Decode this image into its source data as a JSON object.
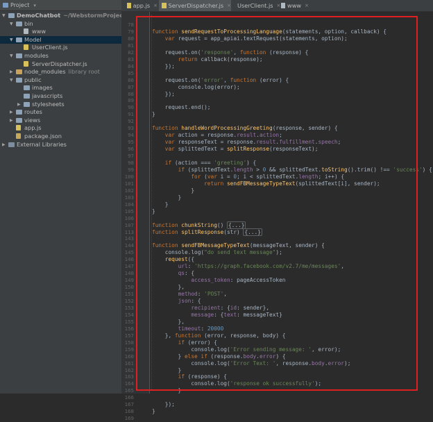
{
  "sidebar": {
    "header_label": "Project",
    "tree": [
      {
        "label": "DemoChatbot",
        "sub": "~/WebstormProjects/Dem",
        "indent": 0,
        "expanded": true,
        "icon": "folder-icon",
        "kind": "folder",
        "bold": true
      },
      {
        "label": "bin",
        "sub": "",
        "indent": 1,
        "expanded": true,
        "icon": "folder-icon",
        "kind": "folder"
      },
      {
        "label": "www",
        "sub": "",
        "indent": 2,
        "expanded": null,
        "icon": "file-icon",
        "kind": "file"
      },
      {
        "label": "Model",
        "sub": "",
        "indent": 1,
        "expanded": true,
        "icon": "folder-icon",
        "kind": "folder",
        "selected": true
      },
      {
        "label": "UserClient.js",
        "sub": "",
        "indent": 2,
        "expanded": null,
        "icon": "js-file-icon",
        "kind": "js"
      },
      {
        "label": "modules",
        "sub": "",
        "indent": 1,
        "expanded": true,
        "icon": "folder-icon",
        "kind": "folder"
      },
      {
        "label": "ServerDispatcher.js",
        "sub": "",
        "indent": 2,
        "expanded": null,
        "icon": "js-file-icon",
        "kind": "js"
      },
      {
        "label": "node_modules",
        "sub": "library root",
        "indent": 1,
        "expanded": false,
        "icon": "folder-icon",
        "kind": "folder-gold"
      },
      {
        "label": "public",
        "sub": "",
        "indent": 1,
        "expanded": true,
        "icon": "folder-icon",
        "kind": "folder"
      },
      {
        "label": "images",
        "sub": "",
        "indent": 2,
        "expanded": null,
        "icon": "folder-icon",
        "kind": "folder"
      },
      {
        "label": "javascripts",
        "sub": "",
        "indent": 2,
        "expanded": null,
        "icon": "folder-icon",
        "kind": "folder"
      },
      {
        "label": "stylesheets",
        "sub": "",
        "indent": 2,
        "expanded": false,
        "icon": "folder-icon",
        "kind": "folder"
      },
      {
        "label": "routes",
        "sub": "",
        "indent": 1,
        "expanded": false,
        "icon": "folder-icon",
        "kind": "folder"
      },
      {
        "label": "views",
        "sub": "",
        "indent": 1,
        "expanded": false,
        "icon": "folder-icon",
        "kind": "folder"
      },
      {
        "label": "app.js",
        "sub": "",
        "indent": 1,
        "expanded": null,
        "icon": "js-file-icon",
        "kind": "js"
      },
      {
        "label": "package.json",
        "sub": "",
        "indent": 1,
        "expanded": null,
        "icon": "json-file-icon",
        "kind": "json"
      },
      {
        "label": "External Libraries",
        "sub": "",
        "indent": 0,
        "expanded": false,
        "icon": "library-icon",
        "kind": "folder-ext"
      }
    ]
  },
  "tabs": [
    {
      "label": "app.js",
      "icon": "js",
      "active": false
    },
    {
      "label": "ServerDispatcher.js",
      "icon": "js",
      "active": true
    },
    {
      "label": "UserClient.js",
      "icon": "js",
      "active": false
    },
    {
      "label": "www",
      "icon": "file",
      "active": false
    }
  ],
  "editor": {
    "lines": [
      {
        "n": "78",
        "code": ""
      },
      {
        "n": "79",
        "code": "<span class=\"kw\">function </span><span class=\"fn\">sendRequestToProcessingLanguage</span>(statements, option, callback) {"
      },
      {
        "n": "80",
        "code": "    <span class=\"kw\">var </span>request = app_apiai.textRequest(statements, option);"
      },
      {
        "n": "81",
        "code": ""
      },
      {
        "n": "82",
        "code": "    request.on(<span class=\"str\">'response'</span>, <span class=\"kw\">function </span>(response) {"
      },
      {
        "n": "83",
        "code": "        <span class=\"kw\">return </span>callback(response);"
      },
      {
        "n": "84",
        "code": "    });"
      },
      {
        "n": "85",
        "code": ""
      },
      {
        "n": "86",
        "code": "    request.on(<span class=\"str\">'error'</span>, <span class=\"kw\">function </span>(error) {"
      },
      {
        "n": "87",
        "code": "        console.log(error);"
      },
      {
        "n": "88",
        "code": "    });"
      },
      {
        "n": "89",
        "code": ""
      },
      {
        "n": "90",
        "code": "    request.end();"
      },
      {
        "n": "91",
        "code": "}"
      },
      {
        "n": "92",
        "code": ""
      },
      {
        "n": "93",
        "code": "<span class=\"kw\">function </span><span class=\"fn\">handleWordProcessingGreeting</span>(response, sender) {"
      },
      {
        "n": "94",
        "code": "    <span class=\"kw\">var </span>action = response.<span class=\"prop\">result</span>.<span class=\"prop\">action</span>;"
      },
      {
        "n": "95",
        "code": "    <span class=\"kw\">var </span>responseText = response.<span class=\"prop\">result</span>.<span class=\"prop\">fulfillment</span>.<span class=\"prop\">speech</span>;"
      },
      {
        "n": "96",
        "code": "    <span class=\"kw\">var </span>splittedText = <span class=\"fn\">splitResponse</span>(responseText);"
      },
      {
        "n": "97",
        "code": ""
      },
      {
        "n": "98",
        "code": "    <span class=\"kw\">if </span>(action === <span class=\"str\">'greeting'</span>) {"
      },
      {
        "n": "99",
        "code": "        <span class=\"kw\">if </span>(splittedText.<span class=\"prop\">length </span>&gt; <span class=\"num\">0 </span>&amp;&amp; splittedText.<span class=\"fn\">toString</span>().trim() !== <span class=\"str\">'success'</span>) {"
      },
      {
        "n": "100",
        "code": "            <span class=\"kw\">for </span>(<span class=\"kw\">var </span>i = <span class=\"num\">0</span>; i &lt; splittedText.<span class=\"prop\">length</span>; i++) {"
      },
      {
        "n": "101",
        "code": "                <span class=\"kw\">return </span><span class=\"fn\">sendFBMessageTypeText</span>(splittedText[i], sender);"
      },
      {
        "n": "102",
        "code": "            }"
      },
      {
        "n": "103",
        "code": "        }"
      },
      {
        "n": "104",
        "code": "    }"
      },
      {
        "n": "105",
        "code": "}"
      },
      {
        "n": "106",
        "code": ""
      },
      {
        "n": "107",
        "code": "<span class=\"kw\">function </span><span class=\"fn\">chunkString</span>() <span class=\"fold\">{...}</span>"
      },
      {
        "n": "113",
        "code": "<span class=\"kw\">function </span><span class=\"fn\">splitResponse</span>(str) <span class=\"fold\">{...}</span>"
      },
      {
        "n": "143",
        "code": ""
      },
      {
        "n": "144",
        "code": "<span class=\"kw\">function </span><span class=\"fn\">sendFBMessageTypeText</span>(messageText, sender) {"
      },
      {
        "n": "145",
        "code": "    console.log(<span class=\"str\">\"do send text message\"</span>);"
      },
      {
        "n": "146",
        "code": "    <span class=\"fn\">request</span>({"
      },
      {
        "n": "147",
        "code": "        <span class=\"prop\">url</span>: <span class=\"str\">'https://graph.facebook.com/v2.7/me/messages'</span>,"
      },
      {
        "n": "148",
        "code": "        <span class=\"prop\">qs</span>: {"
      },
      {
        "n": "149",
        "code": "            <span class=\"prop\">access_token</span>: pageAccessToken"
      },
      {
        "n": "150",
        "code": "        },"
      },
      {
        "n": "151",
        "code": "        <span class=\"prop\">method</span>: <span class=\"str\">'POST'</span>,"
      },
      {
        "n": "152",
        "code": "        <span class=\"prop\">json</span>: {"
      },
      {
        "n": "153",
        "code": "            <span class=\"prop\">recipient</span>: {<span class=\"prop\">id</span>: sender},"
      },
      {
        "n": "154",
        "code": "            <span class=\"prop\">message</span>: {<span class=\"prop\">text</span>: messageText}"
      },
      {
        "n": "155",
        "code": "        },"
      },
      {
        "n": "156",
        "code": "        <span class=\"prop\">timeout</span>: <span class=\"num\">20000</span>"
      },
      {
        "n": "157",
        "code": "    }, <span class=\"kw\">function </span>(error, response, body) {"
      },
      {
        "n": "158",
        "code": "        <span class=\"kw\">if </span>(error) {"
      },
      {
        "n": "159",
        "code": "            console.log(<span class=\"str\">'Error sending message: '</span>, error);"
      },
      {
        "n": "160",
        "code": "        } <span class=\"kw\">else if </span>(response.<span class=\"prop\">body</span>.<span class=\"prop\">error</span>) {"
      },
      {
        "n": "161",
        "code": "            console.log(<span class=\"str\">'Error Text: '</span>, response.<span class=\"prop\">body</span>.<span class=\"prop\">error</span>);"
      },
      {
        "n": "162",
        "code": "        }"
      },
      {
        "n": "163",
        "code": "        <span class=\"kw\">if </span>(response) {"
      },
      {
        "n": "164",
        "code": "            console.log(<span class=\"str\">'response ok successfully'</span>);"
      },
      {
        "n": "165",
        "code": "        }"
      },
      {
        "n": "166",
        "code": ""
      },
      {
        "n": "167",
        "code": "    });"
      },
      {
        "n": "168",
        "code": "}"
      },
      {
        "n": "169",
        "code": ""
      }
    ]
  }
}
